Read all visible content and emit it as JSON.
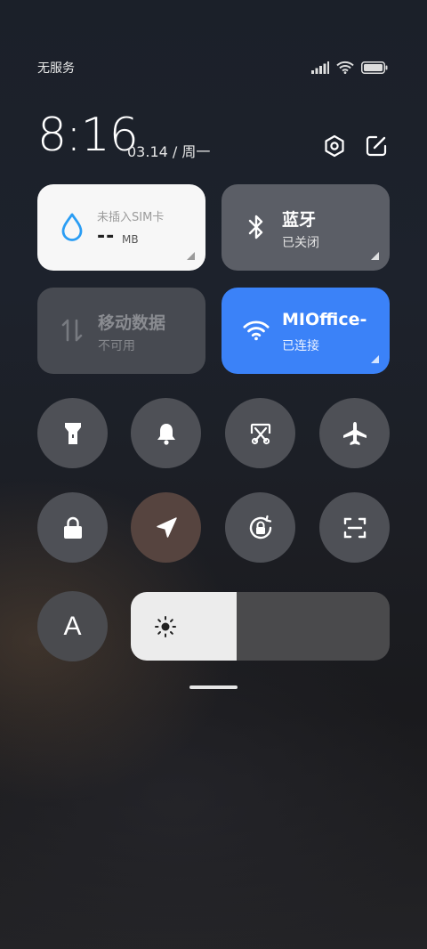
{
  "status_bar": {
    "carrier": "无服务",
    "icons": [
      "signal-icon",
      "wifi-icon",
      "battery-icon"
    ]
  },
  "header": {
    "time": "8:16",
    "date": "03.14 / 周一",
    "icons": [
      "settings-icon",
      "edit-icon"
    ]
  },
  "tiles": {
    "data": {
      "label": "未插入SIM卡",
      "value": "--",
      "unit": "MB",
      "icon": "drop-icon"
    },
    "bluetooth": {
      "title": "蓝牙",
      "status": "已关闭",
      "icon": "bluetooth-icon"
    },
    "mobile_data": {
      "title": "移动数据",
      "status": "不可用",
      "icon": "arrows-updown-icon"
    },
    "wifi": {
      "title": "MIOffice-",
      "status": "已连接",
      "icon": "wifi-icon",
      "accent": "#3b82f8"
    }
  },
  "toggles_row1": [
    "flashlight-icon",
    "bell-icon",
    "screenshot-icon",
    "airplane-icon"
  ],
  "toggles_row2": [
    "lock-icon",
    "location-icon",
    "rotation-lock-icon",
    "scan-icon"
  ],
  "font_toggle": {
    "label": "A"
  },
  "brightness": {
    "level": 0.41,
    "icon": "sun-icon"
  },
  "colors": {
    "tile_white": "#f7f7f7",
    "tile_gray": "#5b5e66",
    "tile_disabled": "#474a51",
    "wifi_blue": "#3b82f8",
    "drop_blue": "#2a9df4"
  }
}
